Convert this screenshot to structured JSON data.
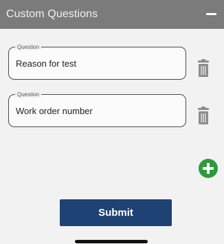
{
  "header": {
    "title": "Custom Questions",
    "collapse_icon": "minus-icon"
  },
  "questions": [
    {
      "label": "Question",
      "value": "Reason for test",
      "delete_icon": "trash-icon"
    },
    {
      "label": "Question",
      "value": "Work order number",
      "delete_icon": "trash-icon"
    }
  ],
  "add_button": {
    "icon": "plus-circle-icon",
    "color": "#2e9a3f"
  },
  "submit": {
    "label": "Submit",
    "color": "#1d4273"
  },
  "colors": {
    "header_bg": "#7b7b7b",
    "panel_bg": "#f2f2f2",
    "trash": "#8c8c8c"
  }
}
